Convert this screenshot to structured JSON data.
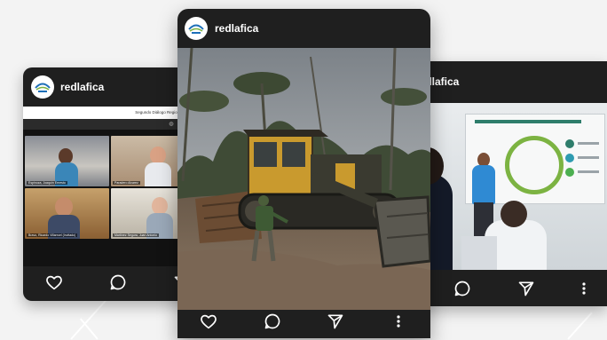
{
  "posts": [
    {
      "username": "redlafica",
      "meeting": {
        "title": "Segundo Diálogo Regional de Política",
        "participants": [
          {
            "name": "Espinoza, Joaquín Ernesto"
          },
          {
            "name": "Paradero Alvarez"
          },
          {
            "name": "Bravo, Ricardo Villarroel (Invitado)"
          },
          {
            "name": "Martínez Segura, Juan Antonio"
          }
        ],
        "self_initials": "JG"
      }
    },
    {
      "username": "redlafica"
    },
    {
      "username": "redlafica"
    }
  ],
  "colors": {
    "card_bg": "#1f1f1f",
    "page_bg": "#f3f3f3",
    "brand_blue": "#1d6fb8",
    "brand_green": "#7cb342"
  },
  "icons": [
    "heart-icon",
    "comment-icon",
    "send-icon",
    "more-vertical-icon"
  ]
}
